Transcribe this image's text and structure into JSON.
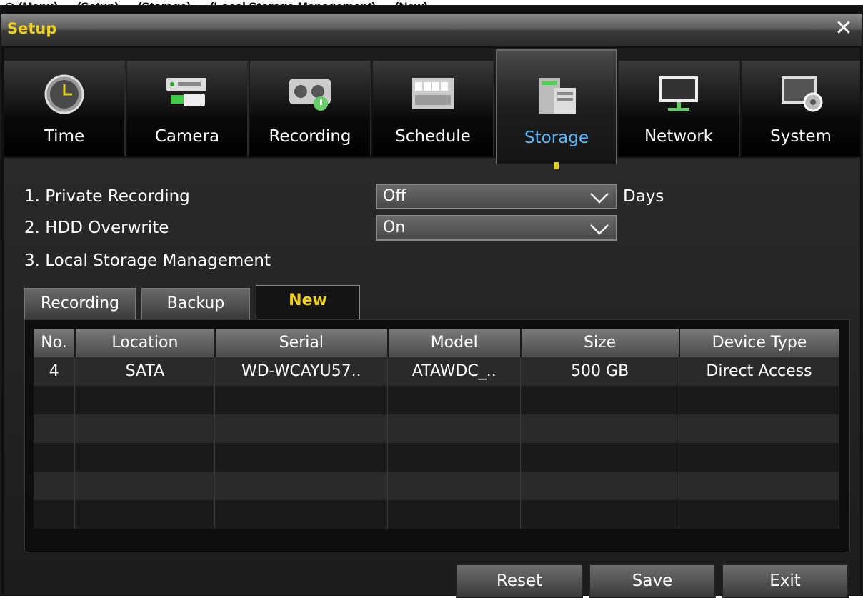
{
  "caption": "◎ (Menu) → (Setup) → (Storage) → (Local Storage Management) → (New)",
  "window": {
    "title": "Setup"
  },
  "tabs": [
    {
      "label": "Time",
      "icon": "clock-icon"
    },
    {
      "label": "Camera",
      "icon": "camera-icon"
    },
    {
      "label": "Recording",
      "icon": "recording-icon"
    },
    {
      "label": "Schedule",
      "icon": "schedule-icon"
    },
    {
      "label": "Storage",
      "icon": "storage-icon",
      "active": true
    },
    {
      "label": "Network",
      "icon": "monitor-icon"
    },
    {
      "label": "System",
      "icon": "system-gear-icon"
    }
  ],
  "settings": {
    "private_recording": {
      "label": "1. Private Recording",
      "value": "Off",
      "unit": "Days"
    },
    "hdd_overwrite": {
      "label": "2. HDD Overwrite",
      "value": "On"
    },
    "local_storage": {
      "label": "3. Local Storage Management"
    }
  },
  "subtabs": [
    {
      "label": "Recording"
    },
    {
      "label": "Backup"
    },
    {
      "label": "New",
      "active": true
    }
  ],
  "table": {
    "headers": [
      "No.",
      "Location",
      "Serial",
      "Model",
      "Size",
      "Device Type"
    ],
    "rows": [
      [
        "4",
        "SATA",
        "WD-WCAYU57..",
        "ATAWDC_..",
        "500 GB",
        "Direct Access"
      ]
    ],
    "empty_rows": 5
  },
  "buttons": {
    "reset": "Reset",
    "save": "Save",
    "exit": "Exit"
  },
  "colors": {
    "accent": "#f0d020",
    "active_tab_text": "#5ab8ff"
  }
}
